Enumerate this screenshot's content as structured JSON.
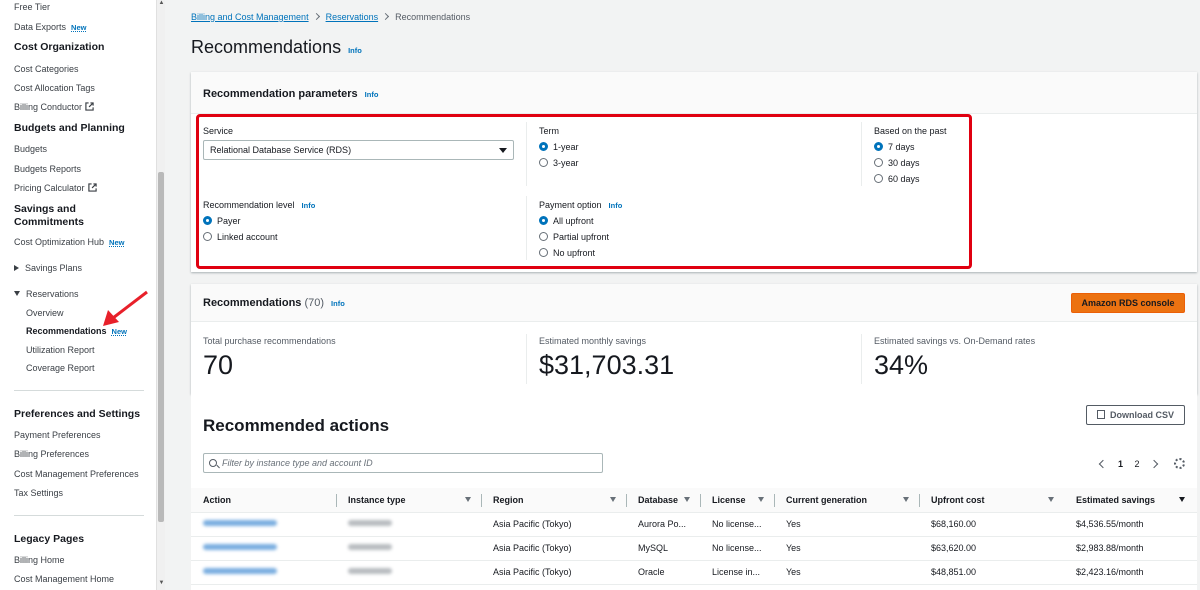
{
  "sidebar": {
    "free_tier": "Free Tier",
    "data_exports": "Data Exports",
    "new_badge": "New",
    "cost_org_head": "Cost Organization",
    "cost_categories": "Cost Categories",
    "cost_allocation_tags": "Cost Allocation Tags",
    "billing_conductor": "Billing Conductor",
    "budgets_head": "Budgets and Planning",
    "budgets": "Budgets",
    "budgets_reports": "Budgets Reports",
    "pricing_calculator": "Pricing Calculator",
    "savings_head": "Savings and Commitments",
    "cost_opt_hub": "Cost Optimization Hub",
    "savings_plans": "Savings Plans",
    "reservations": "Reservations",
    "overview": "Overview",
    "recommendations": "Recommendations",
    "utilization_report": "Utilization Report",
    "coverage_report": "Coverage Report",
    "prefs_head": "Preferences and Settings",
    "payment_prefs": "Payment Preferences",
    "billing_prefs": "Billing Preferences",
    "cost_mgmt_prefs": "Cost Management Preferences",
    "tax_settings": "Tax Settings",
    "legacy_head": "Legacy Pages",
    "billing_home": "Billing Home",
    "cost_mgmt_home": "Cost Management Home"
  },
  "breadcrumb": {
    "item1": "Billing and Cost Management",
    "item2": "Reservations",
    "current": "Recommendations"
  },
  "page": {
    "title": "Recommendations",
    "info": "Info"
  },
  "params": {
    "header": "Recommendation parameters",
    "service_label": "Service",
    "service_value": "Relational Database Service (RDS)",
    "term_label": "Term",
    "term_opts": [
      "1-year",
      "3-year"
    ],
    "term_selected": "1-year",
    "past_label": "Based on the past",
    "past_opts": [
      "7 days",
      "30 days",
      "60 days"
    ],
    "past_selected": "7 days",
    "level_label": "Recommendation level",
    "level_opts": [
      "Payer",
      "Linked account"
    ],
    "level_selected": "Payer",
    "payment_label": "Payment option",
    "payment_opts": [
      "All upfront",
      "Partial upfront",
      "No upfront"
    ],
    "payment_selected": "All upfront"
  },
  "summary": {
    "header": "Recommendations",
    "count": "(70)",
    "console_button": "Amazon RDS console",
    "total_label": "Total purchase recommendations",
    "total_value": "70",
    "monthly_label": "Estimated monthly savings",
    "monthly_value": "$31,703.31",
    "vs_label": "Estimated savings vs. On-Demand rates",
    "vs_value": "34%"
  },
  "actions": {
    "title": "Recommended actions",
    "download": "Download CSV",
    "search_placeholder": "Filter by instance type and account ID",
    "page_current": "1",
    "page_next": "2",
    "columns": [
      "Action",
      "Instance type",
      "Region",
      "Database",
      "License",
      "Current generation",
      "Upfront cost",
      "Estimated savings"
    ],
    "rows": [
      {
        "region": "Asia Pacific (Tokyo)",
        "database": "Aurora Po...",
        "license": "No license...",
        "current_gen": "Yes",
        "upfront": "$68,160.00",
        "savings": "$4,536.55/month"
      },
      {
        "region": "Asia Pacific (Tokyo)",
        "database": "MySQL",
        "license": "No license...",
        "current_gen": "Yes",
        "upfront": "$63,620.00",
        "savings": "$2,983.88/month"
      },
      {
        "region": "Asia Pacific (Tokyo)",
        "database": "Oracle",
        "license": "License in...",
        "current_gen": "Yes",
        "upfront": "$48,851.00",
        "savings": "$2,423.16/month"
      }
    ]
  },
  "colors": {
    "accent": "#0073bb",
    "primary_button": "#ec7211",
    "highlight": "#e00010"
  }
}
